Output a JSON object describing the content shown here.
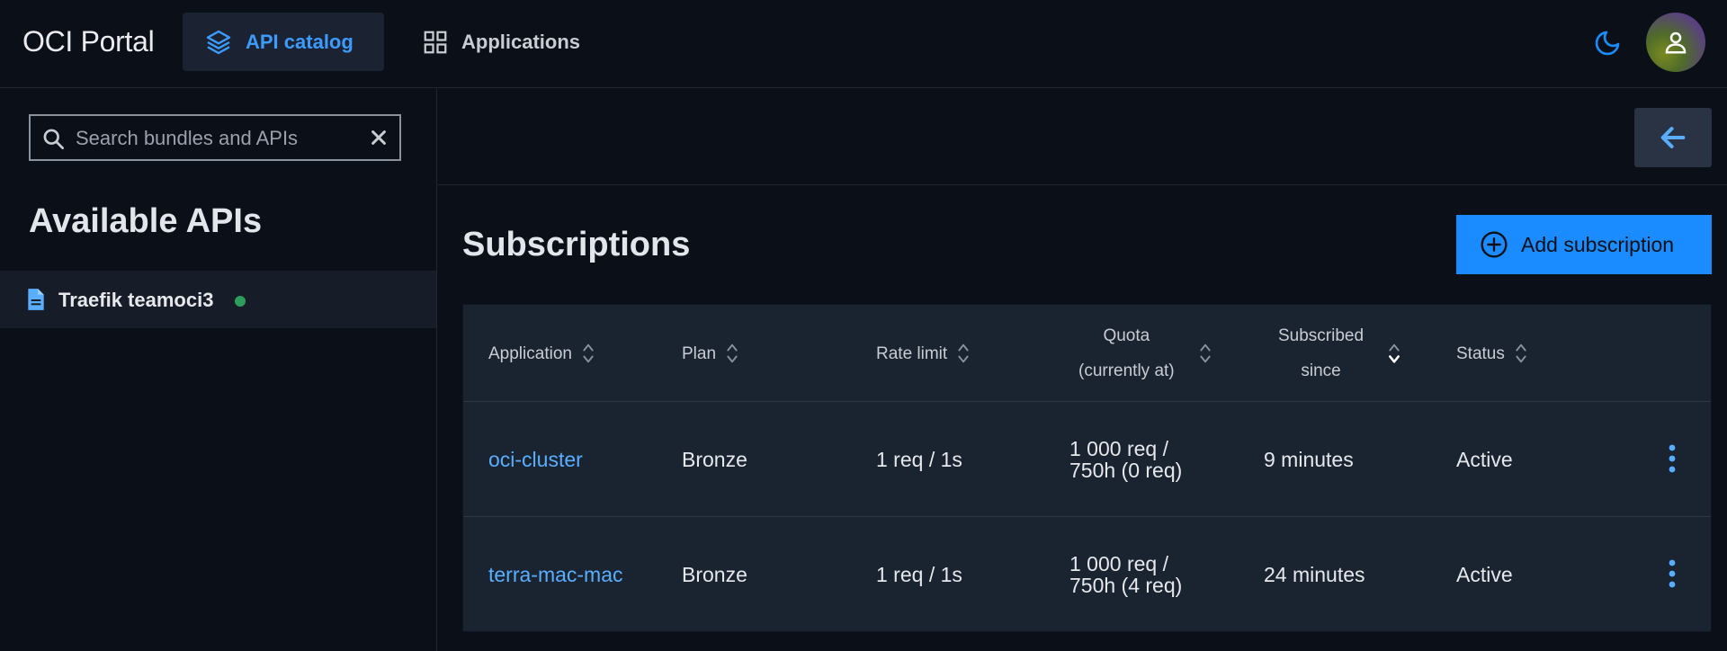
{
  "topbar": {
    "brand": "OCI Portal",
    "tabs": [
      {
        "label": "API catalog",
        "icon": "layers-icon",
        "active": true
      },
      {
        "label": "Applications",
        "icon": "grid-icon",
        "active": false
      }
    ],
    "theme_icon": "moon-icon",
    "avatar_icon": "user-icon"
  },
  "sidebar": {
    "search": {
      "placeholder": "Search bundles and APIs",
      "value": ""
    },
    "title": "Available APIs",
    "items": [
      {
        "label": "Traefik teamoci3",
        "status": "online",
        "status_color": "#2e9d5c"
      }
    ]
  },
  "main": {
    "title": "Subscriptions",
    "add_label": "Add subscription",
    "table": {
      "headers": [
        {
          "key": "application",
          "line1": "Application",
          "line2": ""
        },
        {
          "key": "plan",
          "line1": "Plan",
          "line2": ""
        },
        {
          "key": "rate",
          "line1": "Rate limit",
          "line2": ""
        },
        {
          "key": "quota",
          "line1": "Quota",
          "line2": "(currently at)"
        },
        {
          "key": "since",
          "line1": "Subscribed",
          "line2": "since"
        },
        {
          "key": "status",
          "line1": "Status",
          "line2": ""
        }
      ],
      "rows": [
        {
          "application": "oci-cluster",
          "plan": "Bronze",
          "rate": "1 req / 1s",
          "quota1": "1 000 req /",
          "quota2": "750h (0 req)",
          "since": "9 minutes",
          "status": "Active"
        },
        {
          "application": "terra-mac-mac",
          "plan": "Bronze",
          "rate": "1 req / 1s",
          "quota1": "1 000 req /",
          "quota2": "750h (4 req)",
          "since": "24 minutes",
          "status": "Active"
        }
      ]
    }
  },
  "colors": {
    "accent": "#1a8cff",
    "link": "#5aaeff",
    "background": "#0b0f17",
    "table_bg": "#1a2431"
  }
}
